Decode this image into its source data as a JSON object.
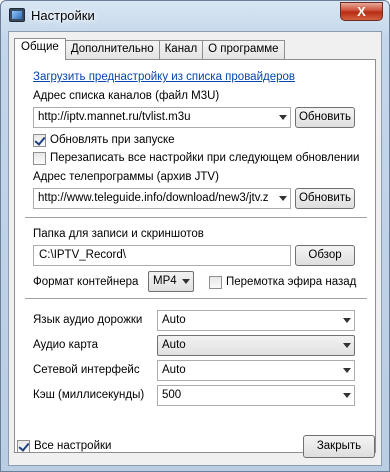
{
  "window": {
    "title": "Настройки",
    "close_label": "X"
  },
  "tabs": [
    {
      "label": "Общие",
      "active": true
    },
    {
      "label": "Дополнительно",
      "active": false
    },
    {
      "label": "Канал",
      "active": false
    },
    {
      "label": "О программе",
      "active": false
    }
  ],
  "general": {
    "provider_link": "Загрузить преднастройку из списка провайдеров",
    "playlist_label": "Адрес списка каналов (файл M3U)",
    "playlist_value": "http://iptv.mannet.ru/tvlist.m3u",
    "refresh_label": "Обновить",
    "update_on_start": {
      "label": "Обновлять при запуске",
      "checked": true
    },
    "overwrite_all": {
      "label": "Перезаписать все настройки при следующем обновлении",
      "checked": false
    },
    "epg_label": "Адрес телепрограммы (архив JTV)",
    "epg_value": "http://www.teleguide.info/download/new3/jtv.z",
    "epg_refresh_label": "Обновить",
    "record_folder_label": "Папка для записи и скриншотов",
    "record_folder_value": "C:\\IPTV_Record\\",
    "browse_label": "Обзор",
    "container_label": "Формат контейнера",
    "container_value": "MP4",
    "timeshift": {
      "label": "Перемотка эфира назад",
      "checked": false
    },
    "audio_track_label": "Язык аудио дорожки",
    "audio_track_value": "Auto",
    "audio_card_label": "Аудио карта",
    "audio_card_value": "Auto",
    "network_label": "Сетевой интерфейс",
    "network_value": "Auto",
    "cache_label": "Кэш (миллисекунды)",
    "cache_value": "500"
  },
  "footer": {
    "all_settings": {
      "label": "Все настройки",
      "checked": true
    },
    "close_button": "Закрыть"
  }
}
